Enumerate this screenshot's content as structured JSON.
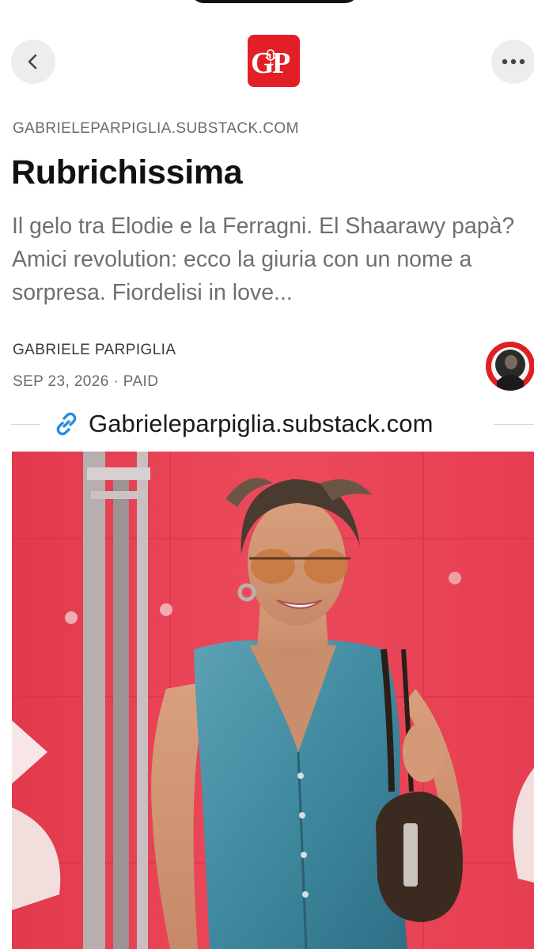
{
  "header": {
    "back_icon": "chevron-left-icon",
    "more_icon": "ellipsis-icon",
    "logo_text": "GP",
    "logo_color": "#e21f26"
  },
  "post": {
    "domain": "GABRIELEPARPIGLIA.SUBSTACK.COM",
    "title": "Rubrichissima",
    "subtitle": "Il gelo tra Elodie e la Ferragni. El Shaarawy papà? Amici revolution: ecco la giuria con un nome a sorpresa. Fiordelisi in love...",
    "author": "GABRIELE PARPIGLIA",
    "meta": "SEP 23, 2026 · PAID",
    "link_text": "Gabrieleparpiglia.substack.com",
    "link_icon": "link-icon",
    "link_icon_color": "#2a8ce0"
  },
  "photo": {
    "background_color": "#e8384d",
    "subject": "woman-in-denim-vest-with-sunglasses"
  }
}
